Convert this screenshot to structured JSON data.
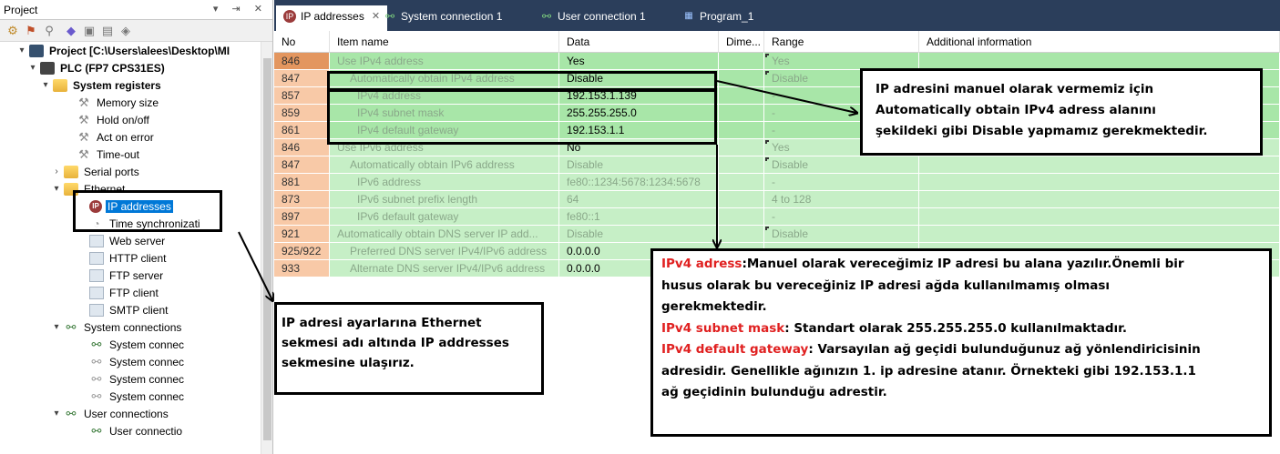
{
  "project_panel": {
    "title": "Project",
    "header_buttons": "▾ ⇥ ✕",
    "tree": [
      {
        "label": "Project [C:\\Users\\alees\\Desktop\\MI",
        "bold": true,
        "arrow": "▾",
        "icon": "project"
      },
      {
        "label": "PLC (FP7 CPS31ES)",
        "bold": true,
        "arrow": "▾",
        "icon": "plc"
      },
      {
        "label": "System registers",
        "bold": true,
        "arrow": "▾",
        "icon": "folder"
      },
      {
        "label": "Memory size",
        "icon": "wrench"
      },
      {
        "label": "Hold on/off",
        "icon": "wrench"
      },
      {
        "label": "Act on error",
        "icon": "wrench"
      },
      {
        "label": "Time-out",
        "icon": "wrench"
      },
      {
        "label": "Serial ports",
        "arrow": "›",
        "icon": "folder"
      },
      {
        "label": "Ethernet",
        "arrow": "▾",
        "icon": "folder-net"
      },
      {
        "label": "IP addresses",
        "icon": "ip",
        "selected": true
      },
      {
        "label": "Time synchronizati",
        "icon": "clock"
      },
      {
        "label": "Web server",
        "icon": "page"
      },
      {
        "label": "HTTP client",
        "icon": "page"
      },
      {
        "label": "FTP server",
        "icon": "page"
      },
      {
        "label": "FTP client",
        "icon": "page"
      },
      {
        "label": "SMTP client",
        "icon": "page"
      },
      {
        "label": "System connections",
        "arrow": "▾",
        "icon": "conn"
      },
      {
        "label": "System connec",
        "icon": "conn"
      },
      {
        "label": "System connec",
        "icon": "conn-grey"
      },
      {
        "label": "System connec",
        "icon": "conn-grey"
      },
      {
        "label": "System connec",
        "icon": "conn-grey"
      },
      {
        "label": "User connections",
        "arrow": "▾",
        "icon": "conn-folder"
      },
      {
        "label": "User connectio",
        "icon": "conn"
      }
    ]
  },
  "tabs": [
    {
      "label": "IP addresses",
      "close": "✕",
      "icon": "ip-icon"
    },
    {
      "label": "System connection 1",
      "icon": "connection-icon"
    },
    {
      "label": "User connection 1",
      "icon": "connection-icon"
    },
    {
      "label": "Program_1",
      "icon": "program-icon"
    }
  ],
  "grid": {
    "columns": [
      "No",
      "Item name",
      "Data",
      "Dime...",
      "Range",
      "Additional information"
    ],
    "rows": [
      {
        "no": "846",
        "item": "Use IPv4 address",
        "data": "Yes",
        "dim": "",
        "range": "Yes",
        "mark": true,
        "dark": true
      },
      {
        "no": "847",
        "item": "Automatically obtain IPv4 address",
        "data": "Disable",
        "dim": "",
        "range": "Disable",
        "mark": true,
        "dark": true
      },
      {
        "no": "857",
        "item": "IPv4 address",
        "data": "192.153.1.139",
        "dim": "",
        "range": "-",
        "dark": true
      },
      {
        "no": "859",
        "item": "IPv4 subnet mask",
        "data": "255.255.255.0",
        "dim": "",
        "range": "-",
        "dark": true
      },
      {
        "no": "861",
        "item": "IPv4 default gateway",
        "data": "192.153.1.1",
        "dim": "",
        "range": "-",
        "dark": true
      },
      {
        "no": "846",
        "item": "Use IPv6 address",
        "data": "No",
        "dim": "",
        "range": "Yes",
        "mark": true,
        "dark": true
      },
      {
        "no": "847",
        "item": "Automatically obtain IPv6 address",
        "data": "Disable",
        "dim": "",
        "range": "Disable",
        "mark": true
      },
      {
        "no": "881",
        "item": "IPv6 address",
        "data": "fe80::1234:5678:1234:5678",
        "dim": "",
        "range": "-"
      },
      {
        "no": "873",
        "item": "IPv6 subnet prefix length",
        "data": "64",
        "dim": "",
        "range": "4 to 128"
      },
      {
        "no": "897",
        "item": "IPv6 default gateway",
        "data": "fe80::1",
        "dim": "",
        "range": "-"
      },
      {
        "no": "921",
        "item": "Automatically obtain DNS server IP add...",
        "data": "Disable",
        "dim": "",
        "range": "Disable",
        "mark": true
      },
      {
        "no": "925/922",
        "item": "Preferred DNS server IPv4/IPv6 address",
        "data": "0.0.0.0",
        "dim": "",
        "range": "",
        "dark": true
      },
      {
        "no": "933",
        "item": "Alternate DNS server IPv4/IPv6 address",
        "data": "0.0.0.0",
        "dim": "",
        "range": "",
        "dark": true
      }
    ]
  },
  "annotations": {
    "right_callout": {
      "line1": "IP adresini manuel olarak vermemiz için",
      "line2": "Automatically obtain IPv4 adress alanını",
      "line3": "şekildeki gibi Disable yapmamız gerekmektedir."
    },
    "left_callout": {
      "line1": "IP adresi ayarlarına Ethernet",
      "line2": "sekmesi adı altında IP addresses",
      "line3": "sekmesine ulaşırız."
    },
    "bottom_callout": {
      "label1": "IPv4 adress",
      "text1a": ":Manuel olarak vereceğimiz IP adresi bu alana yazılır.Önemli bir",
      "text1b": "husus olarak bu vereceğiniz IP adresi ağda kullanılmamış olması",
      "text1c": "gerekmektedir.",
      "label2": "IPv4 subnet mask",
      "text2": ": Standart olarak 255.255.255.0 kullanılmaktadır.",
      "label3": "IPv4 default gateway",
      "text3a": ": Varsayılan ağ geçidi bulunduğunuz ağ yönlendiricisinin",
      "text3b": "adresidir. Genellikle ağınızın 1. ip adresine atanır. Örnekteki gibi 192.153.1.1",
      "text3c": "ağ geçidinin bulunduğu adrestir."
    }
  },
  "colors": {
    "tabbar": "#2b3e5b",
    "row_green": "#c6efc6",
    "no_cell": "#f8c9a7",
    "no_cell_first": "#e3965f",
    "selection": "#0078d7",
    "highlight_red": "#e02020"
  }
}
